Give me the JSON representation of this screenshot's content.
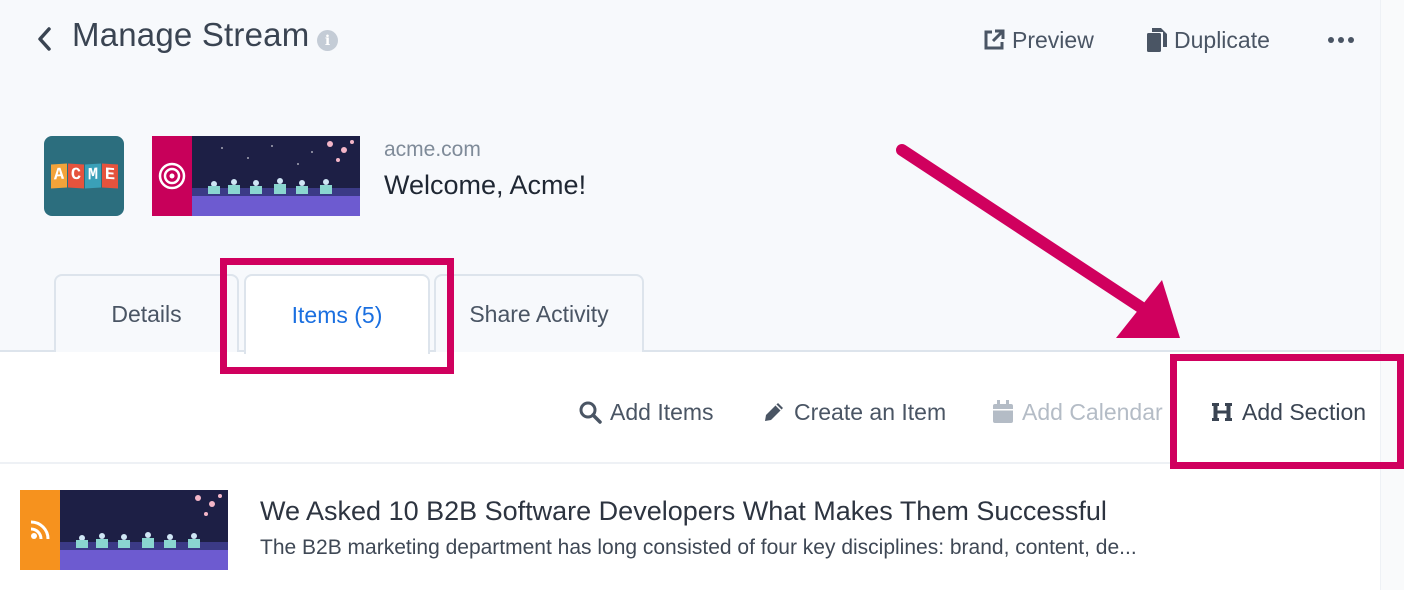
{
  "header": {
    "title": "Manage Stream",
    "preview_label": "Preview",
    "duplicate_label": "Duplicate"
  },
  "stream": {
    "logo_text": [
      "A",
      "C",
      "M",
      "E"
    ],
    "domain": "acme.com",
    "welcome": "Welcome, Acme!"
  },
  "tabs": [
    {
      "label": "Details"
    },
    {
      "label": "Items (5)"
    },
    {
      "label": "Share Activity"
    }
  ],
  "toolbar": {
    "add_items": "Add Items",
    "create_item": "Create an Item",
    "add_calendar": "Add Calendar",
    "add_section": "Add Section"
  },
  "items": [
    {
      "title": "We Asked 10 B2B Software Developers What Makes Them Successful",
      "description": "The B2B marketing department has long consisted of four key disciplines: brand, content, de..."
    }
  ],
  "colors": {
    "accent": "#1a6fe0",
    "highlight": "#d0005e",
    "logo_bg": "#2c6e7e",
    "banner_side": "#c8005a",
    "item_thumb_side": "#f6921e"
  }
}
